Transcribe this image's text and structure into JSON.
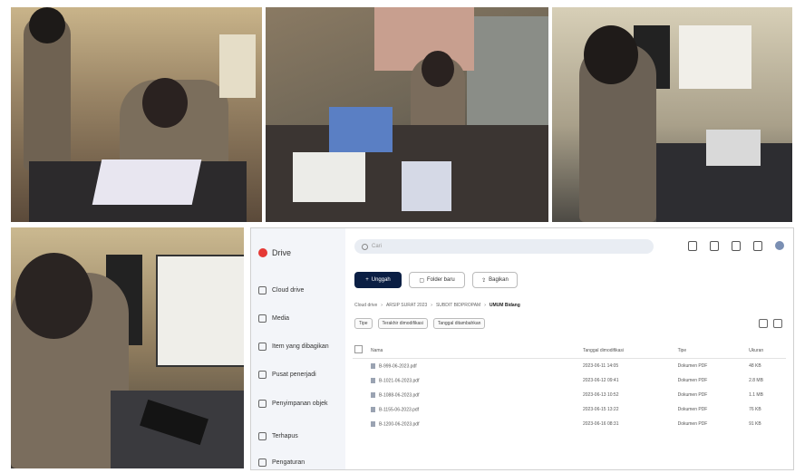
{
  "drive": {
    "logo": "Drive",
    "search_placeholder": "Cari",
    "sidebar": [
      {
        "label": "Cloud drive",
        "icon": "cloud-icon"
      },
      {
        "label": "Media",
        "icon": "media-icon"
      },
      {
        "label": "Item yang dibagikan",
        "icon": "shared-icon"
      },
      {
        "label": "Pusat penerjadi",
        "icon": "sync-icon"
      },
      {
        "label": "Penyimpanan objek",
        "icon": "storage-icon"
      },
      {
        "label": "Terhapus",
        "icon": "trash-icon"
      },
      {
        "label": "Pengaturan",
        "icon": "settings-icon"
      }
    ],
    "buttons": {
      "upload": "Unggah",
      "new_folder": "Folder baru",
      "share": "Bagikan"
    },
    "breadcrumb": [
      "Cloud drive",
      "ARSIP SURAT 2023",
      "SUBDIT BIDPROPAM",
      "UMUM Bidang"
    ],
    "filters": [
      "Tipe",
      "Terakhir dimodifikasi",
      "Tanggal ditambahkan"
    ],
    "columns": [
      "Nama",
      "Tanggal dimodifikasi",
      "Tipe",
      "Ukuran"
    ],
    "files": [
      {
        "name": "B-999-06-2023.pdf",
        "date": "2023-06-11 14:05",
        "type": "Dokumen PDF",
        "size": "48 KB"
      },
      {
        "name": "B-1021-06-2023.pdf",
        "date": "2023-06-12 09:41",
        "type": "Dokumen PDF",
        "size": "2.8 MB"
      },
      {
        "name": "B-1088-06-2023.pdf",
        "date": "2023-06-13 10:52",
        "type": "Dokumen PDF",
        "size": "1.1 MB"
      },
      {
        "name": "B-1155-06-2023.pdf",
        "date": "2023-06-15 13:22",
        "type": "Dokumen PDF",
        "size": "76 KB"
      },
      {
        "name": "B-1200-06-2023.pdf",
        "date": "2023-06-16 08:31",
        "type": "Dokumen PDF",
        "size": "91 KB"
      }
    ]
  }
}
